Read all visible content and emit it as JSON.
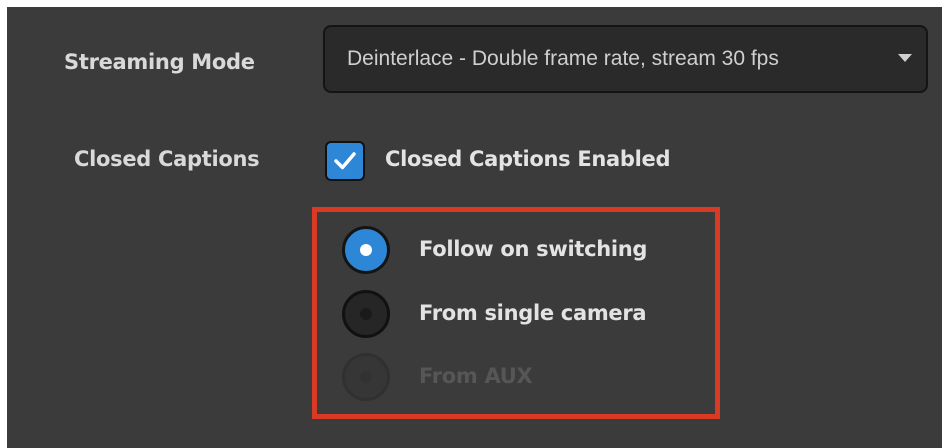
{
  "settings": {
    "streaming_mode": {
      "label": "Streaming Mode",
      "value": "Deinterlace - Double frame rate, stream 30 fps",
      "icon": "chevron-down-icon"
    },
    "closed_captions": {
      "label": "Closed Captions",
      "checkbox_label": "Closed Captions Enabled",
      "enabled": true,
      "source_options": [
        {
          "label": "Follow on switching",
          "selected": true,
          "disabled": false
        },
        {
          "label": "From single camera",
          "selected": false,
          "disabled": false
        },
        {
          "label": "From AUX",
          "selected": false,
          "disabled": true
        }
      ]
    }
  },
  "colors": {
    "panel_background": "#3b3b3b",
    "accent_blue": "#2e86d6",
    "highlight_red": "#d83a25"
  }
}
